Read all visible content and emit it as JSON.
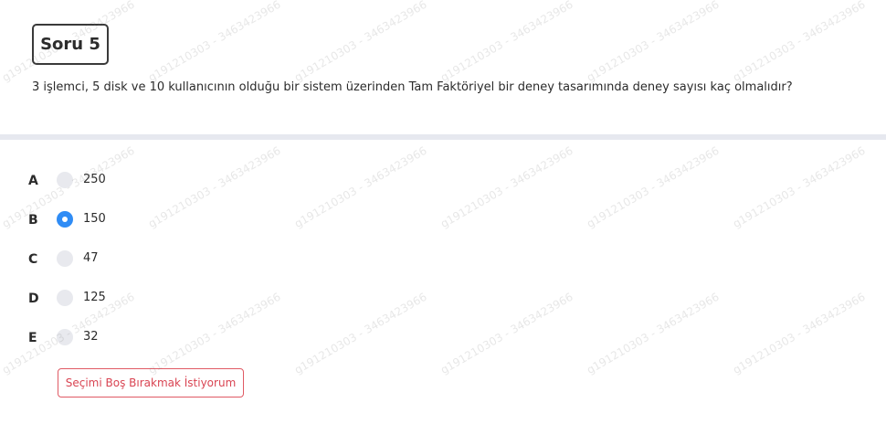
{
  "question": {
    "badge": "Soru 5",
    "text": "3 işlemci, 5 disk ve 10 kullanıcının olduğu bir sistem üzerinden Tam Faktöriyel bir deney tasarımında deney sayısı kaç olmalıdır?"
  },
  "options": [
    {
      "letter": "A",
      "value": "250",
      "selected": false
    },
    {
      "letter": "B",
      "value": "150",
      "selected": true
    },
    {
      "letter": "C",
      "value": "47",
      "selected": false
    },
    {
      "letter": "D",
      "value": "125",
      "selected": false
    },
    {
      "letter": "E",
      "value": "32",
      "selected": false
    }
  ],
  "actions": {
    "leave_blank_label": "Seçimi Boş Bırakmak İstiyorum"
  },
  "watermark": {
    "text": "g191210303 - 3463423966"
  },
  "colors": {
    "selected_radio": "#2f8cf5",
    "blank_button_border": "#e05a64",
    "divider": "#e6e8ef"
  }
}
